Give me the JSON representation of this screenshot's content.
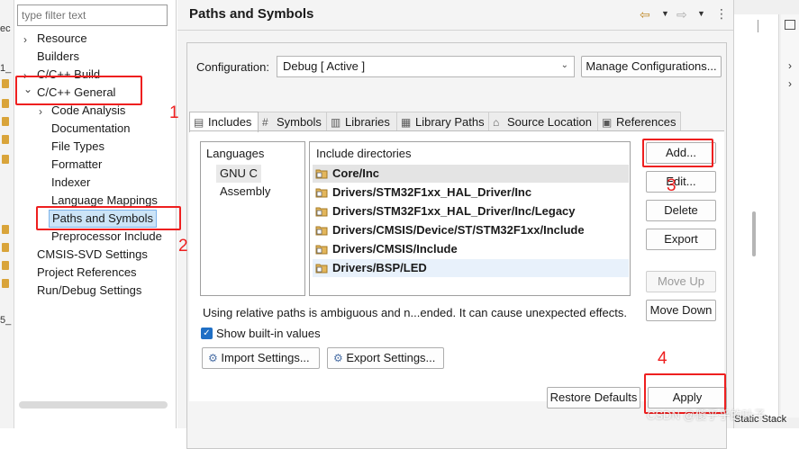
{
  "background": {
    "left_fragments": [
      "ec",
      "1_",
      "5_"
    ],
    "right_status": "Static Stack"
  },
  "tree": {
    "filter_placeholder": "type filter text",
    "items": [
      {
        "label": "Resource",
        "arrow": "›"
      },
      {
        "label": "Builders",
        "arrow": ""
      },
      {
        "label": "C/C++ Build",
        "arrow": "›"
      },
      {
        "label": "C/C++ General",
        "arrow": "⌄"
      },
      {
        "label": "Code Analysis",
        "arrow": "›"
      },
      {
        "label": "Documentation",
        "arrow": ""
      },
      {
        "label": "File Types",
        "arrow": ""
      },
      {
        "label": "Formatter",
        "arrow": ""
      },
      {
        "label": "Indexer",
        "arrow": ""
      },
      {
        "label": "Language Mappings",
        "arrow": ""
      },
      {
        "label": "Paths and Symbols",
        "arrow": ""
      },
      {
        "label": "Preprocessor Include",
        "arrow": ""
      },
      {
        "label": "CMSIS-SVD Settings",
        "arrow": ""
      },
      {
        "label": "Project References",
        "arrow": ""
      },
      {
        "label": "Run/Debug Settings",
        "arrow": ""
      }
    ]
  },
  "header": {
    "title": "Paths and Symbols",
    "kebab": "⋮"
  },
  "config": {
    "label": "Configuration:",
    "value": "Debug  [ Active ]",
    "manage_button": "Manage Configurations..."
  },
  "tabs": [
    {
      "label": "Includes",
      "icon": "includes-icon",
      "glyph": "▤"
    },
    {
      "label": "Symbols",
      "icon": "hash-icon",
      "glyph": "#"
    },
    {
      "label": "Libraries",
      "icon": "libraries-icon",
      "glyph": "▥"
    },
    {
      "label": "Library Paths",
      "icon": "library-paths-icon",
      "glyph": "▦"
    },
    {
      "label": "Source Location",
      "icon": "source-location-icon",
      "glyph": "⌂"
    },
    {
      "label": "References",
      "icon": "references-icon",
      "glyph": "▣"
    }
  ],
  "languages": {
    "header": "Languages",
    "items": [
      "GNU C",
      "Assembly"
    ]
  },
  "includes": {
    "header": "Include directories",
    "items": [
      "Core/Inc",
      "Drivers/STM32F1xx_HAL_Driver/Inc",
      "Drivers/STM32F1xx_HAL_Driver/Inc/Legacy",
      "Drivers/CMSIS/Device/ST/STM32F1xx/Include",
      "Drivers/CMSIS/Include",
      "Drivers/BSP/LED"
    ]
  },
  "buttons": {
    "add": "Add...",
    "edit": "Edit...",
    "delete": "Delete",
    "export": "Export",
    "move_up": "Move Up",
    "move_down": "Move Down",
    "import_settings": "Import Settings...",
    "export_settings": "Export Settings...",
    "restore_defaults": "Restore Defaults",
    "apply": "Apply"
  },
  "note": "Using relative paths is ambiguous and n...ended. It can cause unexpected effects.",
  "show_builtin": {
    "label": "Show built-in values",
    "checked": true
  },
  "annotations": [
    "1",
    "2",
    "3",
    "4"
  ],
  "watermark": "CSDN @傻乎乎的叶子",
  "colors": {
    "annotation": "#ee1f1f",
    "accent": "#1f6fc5",
    "folder": "#d9a43a"
  }
}
